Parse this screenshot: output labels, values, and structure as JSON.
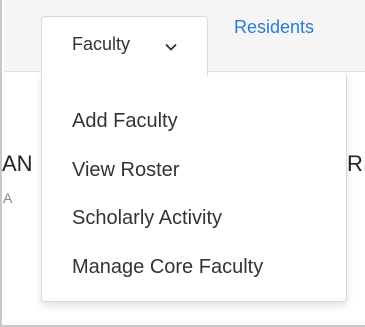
{
  "nav": {
    "faculty_tab": {
      "label": "Faculty",
      "icon": "chevron-down-icon"
    },
    "residents_tab": {
      "label": "Residents",
      "icon": "chevron-down-icon"
    }
  },
  "dropdown": {
    "items": [
      {
        "label": "Add Faculty"
      },
      {
        "label": "View Roster"
      },
      {
        "label": "Scholarly Activity"
      },
      {
        "label": "Manage Core Faculty"
      }
    ]
  },
  "background": {
    "left_header_fragment": "AN",
    "left_sub_fragment": "A",
    "right_header_fragment": "RI"
  },
  "colors": {
    "nav_background": "#f5f5f5",
    "active_tab_text": "#333333",
    "inactive_tab_text": "#2a7bd3",
    "menu_text": "#333333",
    "border": "#d9d9d9"
  }
}
